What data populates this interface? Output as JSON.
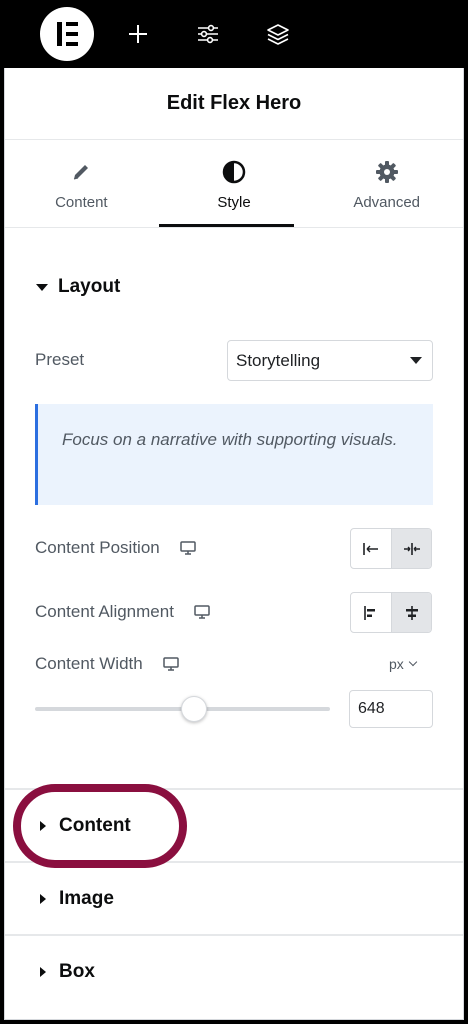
{
  "editor": {
    "topbar": {
      "logo": "elementor-logo",
      "buttons": [
        "plus-icon",
        "sliders-icon",
        "layers-icon"
      ]
    },
    "panel_title": "Edit Flex Hero",
    "tabs": [
      {
        "label": "Content",
        "icon": "pencil-icon"
      },
      {
        "label": "Style",
        "icon": "contrast-icon",
        "active": true
      },
      {
        "label": "Advanced",
        "icon": "gear-icon"
      }
    ],
    "layout": {
      "title": "Layout",
      "preset_label": "Preset",
      "preset_value": "Storytelling",
      "info_text": "Focus on a narrative with supporting visuals.",
      "content_position_label": "Content Position",
      "content_alignment_label": "Content Alignment",
      "content_width_label": "Content Width",
      "content_width_unit": "px",
      "content_width_value": "648"
    },
    "sections": [
      {
        "title": "Content"
      },
      {
        "title": "Image"
      },
      {
        "title": "Box"
      }
    ]
  },
  "colors": {
    "accent": "#2c6fe0",
    "highlight": "#8a0f3f",
    "info_bg": "#ebf3fd"
  }
}
